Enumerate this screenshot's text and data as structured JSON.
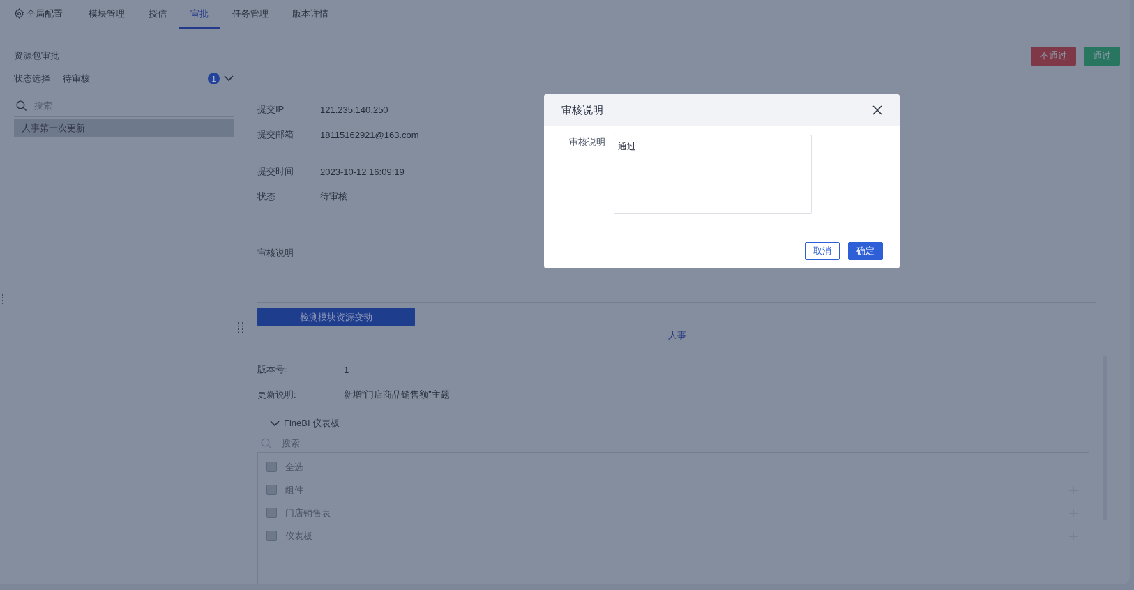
{
  "nav": {
    "tabs": [
      {
        "label": "全局配置",
        "kind": "settings",
        "selected": false
      },
      {
        "label": "模块管理",
        "kind": "plain",
        "selected": false
      },
      {
        "label": "授信",
        "kind": "plain",
        "selected": false
      },
      {
        "label": "审批",
        "kind": "plain",
        "selected": true
      },
      {
        "label": "任务管理",
        "kind": "plain",
        "selected": false
      },
      {
        "label": "版本详情",
        "kind": "plain",
        "selected": false
      }
    ]
  },
  "page_title": "资源包审批",
  "actions": [
    {
      "label": "不通过",
      "kind": "reject"
    },
    {
      "label": "通过",
      "kind": "approve"
    }
  ],
  "sidebar": {
    "status_label": "状态选择",
    "status_value": "待审核",
    "badge": "1",
    "search_placeholder": "搜索",
    "items": [
      {
        "label": "人事第一次更新",
        "selected": true
      }
    ]
  },
  "details": [
    {
      "label": "提交IP",
      "value": "121.235.140.250"
    },
    {
      "label": "提交邮箱",
      "value": "18115162921@163.com"
    },
    {
      "label": "提交时间",
      "value": "2023-10-12 16:09:19"
    },
    {
      "label": "状态",
      "value": "待审核"
    },
    {
      "label": "审核说明"
    }
  ],
  "detect_button": "检测模块资源变动",
  "module_title": "人事",
  "version": {
    "label": "版本号:",
    "value": "1"
  },
  "update": {
    "label": "更新说明:",
    "value": "新增“门店商品销售额”主题"
  },
  "tree": {
    "title": "FineBI 仪表板",
    "expanded": true,
    "search_placeholder": "搜索",
    "items": [
      {
        "label": "全选",
        "checked": false,
        "disabled": true,
        "expandable": false
      },
      {
        "label": "组件",
        "checked": false,
        "disabled": true,
        "expandable": true
      },
      {
        "label": "门店销售表",
        "checked": false,
        "disabled": true,
        "expandable": true
      },
      {
        "label": "仪表板",
        "checked": false,
        "disabled": true,
        "expandable": true
      }
    ]
  },
  "dialog": {
    "title": "审核说明",
    "field_label": "审核说明",
    "value": "通过",
    "buttons": [
      {
        "label": "取消",
        "kind": "secondary"
      },
      {
        "label": "确定",
        "kind": "primary"
      }
    ]
  }
}
